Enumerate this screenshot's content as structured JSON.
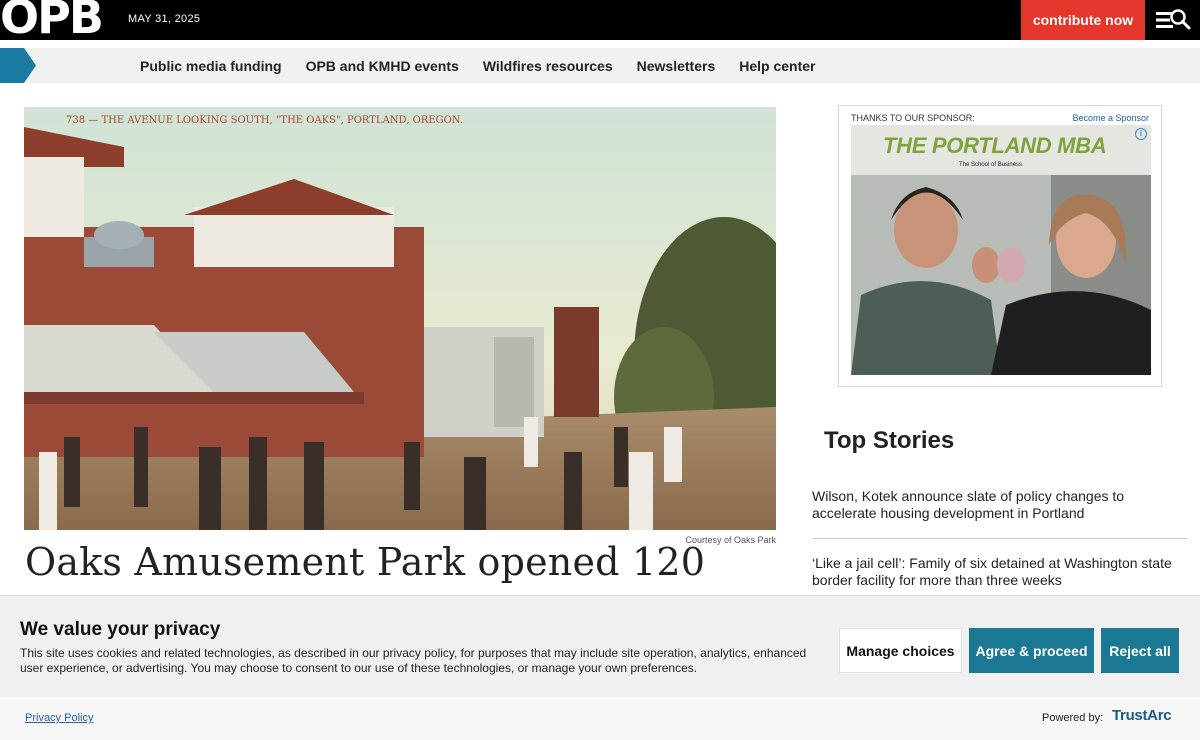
{
  "header": {
    "logo": "OPB",
    "date": "MAY 31, 2025",
    "contribute_label": "contribute now",
    "brand_red": "#e4362a"
  },
  "nav": {
    "items": [
      {
        "label": "Public media funding"
      },
      {
        "label": "OPB and KMHD events"
      },
      {
        "label": "Wildfires resources"
      },
      {
        "label": "Newsletters"
      },
      {
        "label": "Help center"
      }
    ]
  },
  "article": {
    "postcard_caption": "738 — THE AVENUE LOOKING SOUTH, \"THE OAKS\", PORTLAND, OREGON.",
    "image_credit": "Courtesy of Oaks Park",
    "headline": "Oaks Amusement Park opened 120"
  },
  "sponsor": {
    "label": "THANKS TO OUR SPONSOR:",
    "link": "Become a Sponsor",
    "ad_title": "THE PORTLAND MBA",
    "ad_sub": "The School of Business",
    "info": "i"
  },
  "top_stories": {
    "heading": "Top Stories",
    "items": [
      {
        "title": "Wilson, Kotek announce slate of policy changes to accelerate housing development in Portland"
      },
      {
        "title": "‘Like a jail cell’: Family of six detained at Washington state border facility for more than three weeks"
      }
    ]
  },
  "consent": {
    "title": "We value your privacy",
    "text": "This site uses cookies and related technologies, as described in our privacy policy, for purposes that may include site operation, analytics, enhanced user experience, or advertising. You may choose to consent to our use of these technologies, or manage your own preferences.",
    "manage_label": "Manage choices",
    "agree_label": "Agree & proceed",
    "reject_label": "Reject all",
    "button_color": "#1b7893",
    "privacy_link": "Privacy Policy",
    "powered_by": "Powered by:",
    "vendor": "TrustArc"
  }
}
